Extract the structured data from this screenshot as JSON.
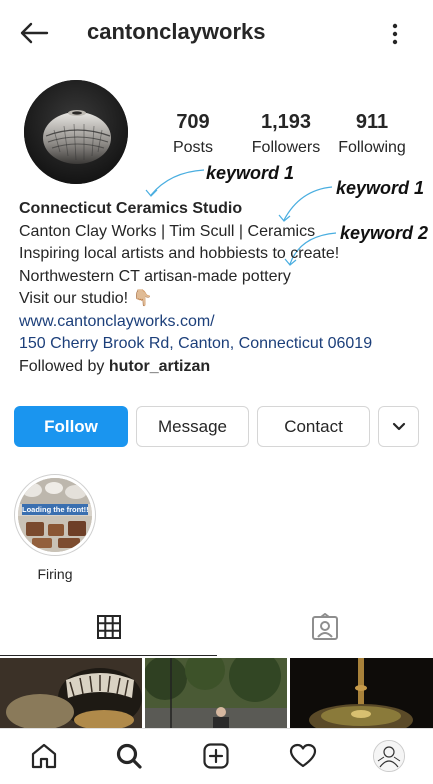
{
  "header": {
    "username": "cantonclayworks",
    "back_icon": "arrow-left-icon",
    "more_icon": "more-vertical-icon"
  },
  "stats": {
    "posts_count": "709",
    "posts_label": "Posts",
    "followers_count": "1,193",
    "followers_label": "Followers",
    "following_count": "911",
    "following_label": "Following"
  },
  "bio": {
    "name": "Connecticut Ceramics Studio",
    "line1": "Canton Clay Works | Tim Scull | Ceramics",
    "line2": "Inspiring local artists and hobbiests to create!",
    "line3": "Northwestern CT artisan-made pottery",
    "line4": "Visit our studio! 👇🏼",
    "website": "www.cantonclayworks.com/",
    "address": "150 Cherry Brook Rd, Canton, Connecticut 06019",
    "followed_by_prefix": "Followed by ",
    "followed_by_user": "hutor_artizan"
  },
  "annotations": {
    "kw1": "keyword 1",
    "kw2": "keyword 1",
    "kw3": "keyword 2",
    "arrow_color": "#4aaee0"
  },
  "actions": {
    "follow": "Follow",
    "message": "Message",
    "contact": "Contact",
    "more_icon": "chevron-down-icon"
  },
  "highlights": [
    {
      "label": "Firing",
      "cover_caption": "Loading the front!!"
    }
  ],
  "tabs": {
    "grid_icon": "grid-icon",
    "tagged_icon": "tagged-person-icon",
    "active": "grid"
  },
  "bottom_nav": [
    "home-icon",
    "search-icon",
    "add-post-icon",
    "heart-icon",
    "profile-avatar"
  ],
  "colors": {
    "accent": "#1a95ef",
    "link": "#1c3f7a",
    "text": "#262626",
    "border": "#d6d6d6"
  }
}
